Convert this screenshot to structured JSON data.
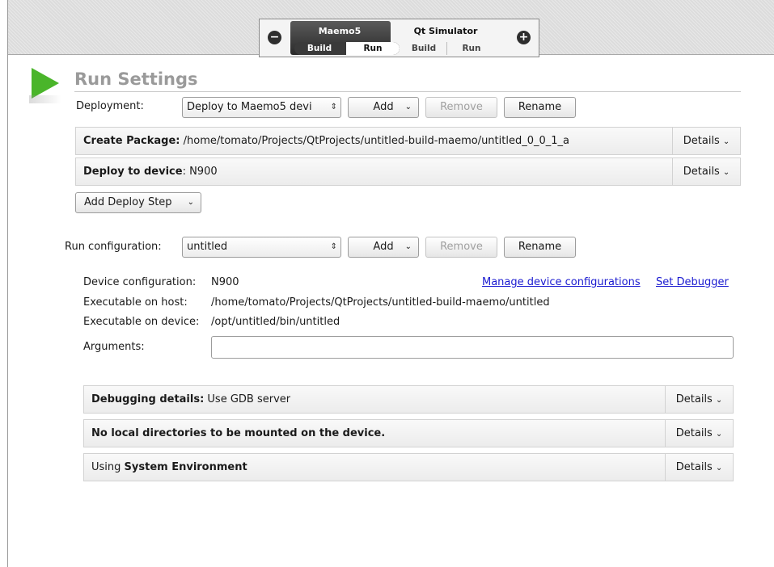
{
  "targets": {
    "maemo": {
      "name": "Maemo5",
      "build": "Build",
      "run": "Run"
    },
    "qt": {
      "name": "Qt Simulator",
      "build": "Build",
      "run": "Run"
    },
    "remove_symbol": "−",
    "add_symbol": "+"
  },
  "page_title": "Run Settings",
  "deployment": {
    "label": "Deployment:",
    "value": "Deploy to Maemo5 devi",
    "add": "Add",
    "remove": "Remove",
    "rename": "Rename"
  },
  "deploy_steps": [
    {
      "title_bold": "Create Package:",
      "title_rest": " /home/tomato/Projects/QtProjects/untitled-build-maemo/untitled_0_0_1_a",
      "details": "Details"
    },
    {
      "title_bold": "Deploy to device",
      "title_rest": ": N900",
      "details": "Details"
    }
  ],
  "add_deploy_step": "Add Deploy Step",
  "run_config": {
    "label": "Run configuration:",
    "value": "untitled",
    "add": "Add",
    "remove": "Remove",
    "rename": "Rename"
  },
  "device": {
    "config_label": "Device configuration:",
    "config_value": "N900",
    "manage_link": "Manage device configurations",
    "debugger_link": "Set Debugger",
    "host_label": "Executable on host:",
    "host_value": "/home/tomato/Projects/QtProjects/untitled-build-maemo/untitled",
    "device_label": "Executable on device:",
    "device_value": "/opt/untitled/bin/untitled",
    "arguments_label": "Arguments:",
    "arguments_value": ""
  },
  "run_panels": [
    {
      "title_pre": "",
      "title_bold": "Debugging details:",
      "title_rest": " Use GDB server",
      "details": "Details"
    },
    {
      "title_pre": "",
      "title_bold": "No local directories to be mounted on the device.",
      "title_rest": "",
      "details": "Details"
    },
    {
      "title_pre": "Using ",
      "title_bold": "System Environment",
      "title_rest": "",
      "details": "Details"
    }
  ],
  "colors": {
    "run_icon": "#4ab52a",
    "link": "#1a1ad0"
  }
}
